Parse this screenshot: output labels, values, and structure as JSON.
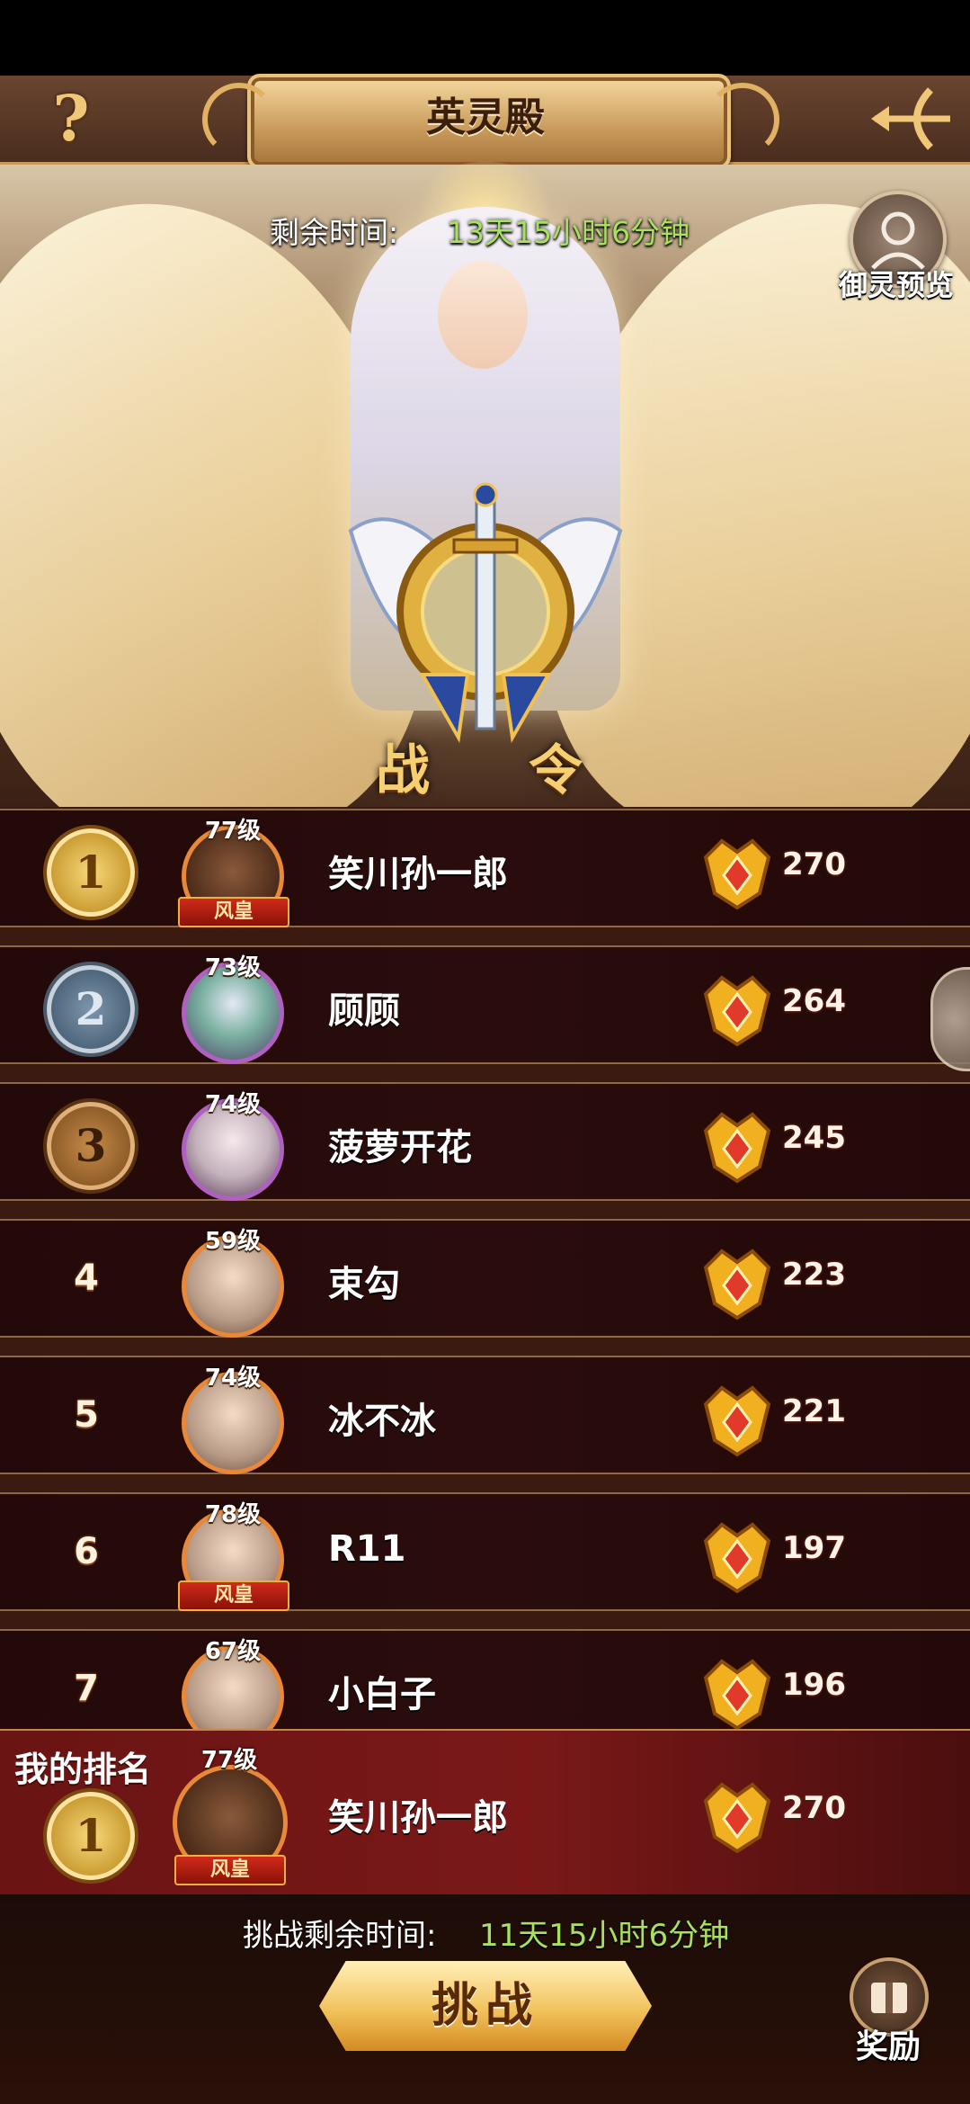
{
  "header": {
    "title": "英灵殿",
    "help_icon": "question-mark-icon",
    "back_icon": "bow-arrow-back-icon"
  },
  "event": {
    "remaining_label": "剩余时间:",
    "remaining_value": "13天15小时6分钟",
    "preview_label": "御灵预览",
    "order_label_1": "战",
    "order_label_2": "令"
  },
  "colors": {
    "accent_green": "#a8e060",
    "gold": "#f6cf70",
    "row_bg": "#2a0c0c",
    "my_row_bg": "#7a1818"
  },
  "ranking": [
    {
      "rank": "1",
      "level": "77级",
      "vip": "风皇",
      "name": "笑川孙一郎",
      "score": "270"
    },
    {
      "rank": "2",
      "level": "73级",
      "vip": "",
      "name": "顾顾",
      "score": "264"
    },
    {
      "rank": "3",
      "level": "74级",
      "vip": "",
      "name": "菠萝开花",
      "score": "245"
    },
    {
      "rank": "4",
      "level": "59级",
      "vip": "",
      "name": "束勾",
      "score": "223"
    },
    {
      "rank": "5",
      "level": "74级",
      "vip": "",
      "name": "冰不冰",
      "score": "221"
    },
    {
      "rank": "6",
      "level": "78级",
      "vip": "风皇",
      "name": "R11",
      "score": "197"
    },
    {
      "rank": "7",
      "level": "67级",
      "vip": "",
      "name": "小白子",
      "score": "196"
    }
  ],
  "my_rank": {
    "label": "我的排名",
    "rank": "1",
    "level": "77级",
    "vip": "风皇",
    "name": "笑川孙一郎",
    "score": "270"
  },
  "footer": {
    "challenge_label": "挑战剩余时间:",
    "challenge_value": "11天15小时6分钟",
    "challenge_button": "挑战",
    "reward_label": "奖励"
  }
}
